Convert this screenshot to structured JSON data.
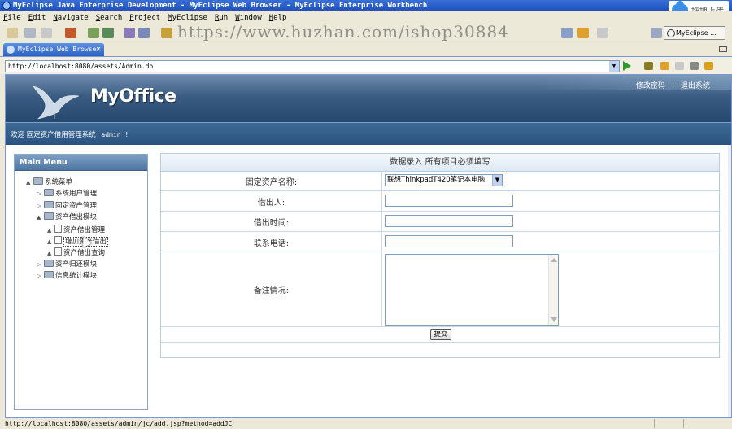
{
  "window": {
    "title": "MyEclipse Java Enterprise Development - MyEclipse Web Browser - MyEclipse Enterprise Workbench",
    "upload_badge": "拖拽上传"
  },
  "menu": [
    "File",
    "Edit",
    "Navigate",
    "Search",
    "Project",
    "MyEclipse",
    "Run",
    "Window",
    "Help"
  ],
  "watermark": "https://www.huzhan.com/ishop30884",
  "perspective_label": "MyEclipse ...",
  "tab": {
    "label": "MyEclipse Web Browser",
    "close": "✕"
  },
  "browser": {
    "url": "http://localhost:8080/assets/Admin.do"
  },
  "app": {
    "logo_text": "MyOffice",
    "header_links": [
      "修改密码",
      "退出系统"
    ],
    "header_sep": "|",
    "welcome": "欢迎  固定资产借用管理系统",
    "welcome_user": "admin !"
  },
  "side_menu": {
    "title": "Main Menu",
    "items": [
      {
        "label": "系统菜单",
        "level": 0,
        "toggle": "▲",
        "icon": "folder-icon"
      },
      {
        "label": "系统用户管理",
        "level": 1,
        "toggle": "▷",
        "icon": "folder-icon"
      },
      {
        "label": "固定资产管理",
        "level": 1,
        "toggle": "▷",
        "icon": "folder-icon"
      },
      {
        "label": "资产借出模块",
        "level": 1,
        "toggle": "▲",
        "icon": "folder-icon"
      },
      {
        "label": "资产借出管理",
        "level": 2,
        "toggle": "▲",
        "icon": "document-icon"
      },
      {
        "label": "增加资产借出",
        "level": 2,
        "toggle": "▲",
        "icon": "document-icon"
      },
      {
        "label": "资产借出查询",
        "level": 2,
        "toggle": "▲",
        "icon": "document-icon"
      },
      {
        "label": "资产归还模块",
        "level": 1,
        "toggle": "▷",
        "icon": "folder-icon"
      },
      {
        "label": "信息统计模块",
        "level": 1,
        "toggle": "▷",
        "icon": "folder-icon"
      }
    ]
  },
  "form": {
    "caption": "数据录入  所有项目必须填写",
    "asset_label": "固定资产名称:",
    "asset_value": "联想ThinkpadT420笔记本电脑",
    "borrower_label": "借出人:",
    "borrower_value": "",
    "borrow_time_label": "借出时间:",
    "borrow_time_value": "",
    "phone_label": "联系电话:",
    "phone_value": "",
    "remark_label": "备注情况:",
    "remark_value": "",
    "submit_label": "提交"
  },
  "status": {
    "text": "http://localhost:8080/assets/admin/jc/add.jsp?method=addJC"
  }
}
